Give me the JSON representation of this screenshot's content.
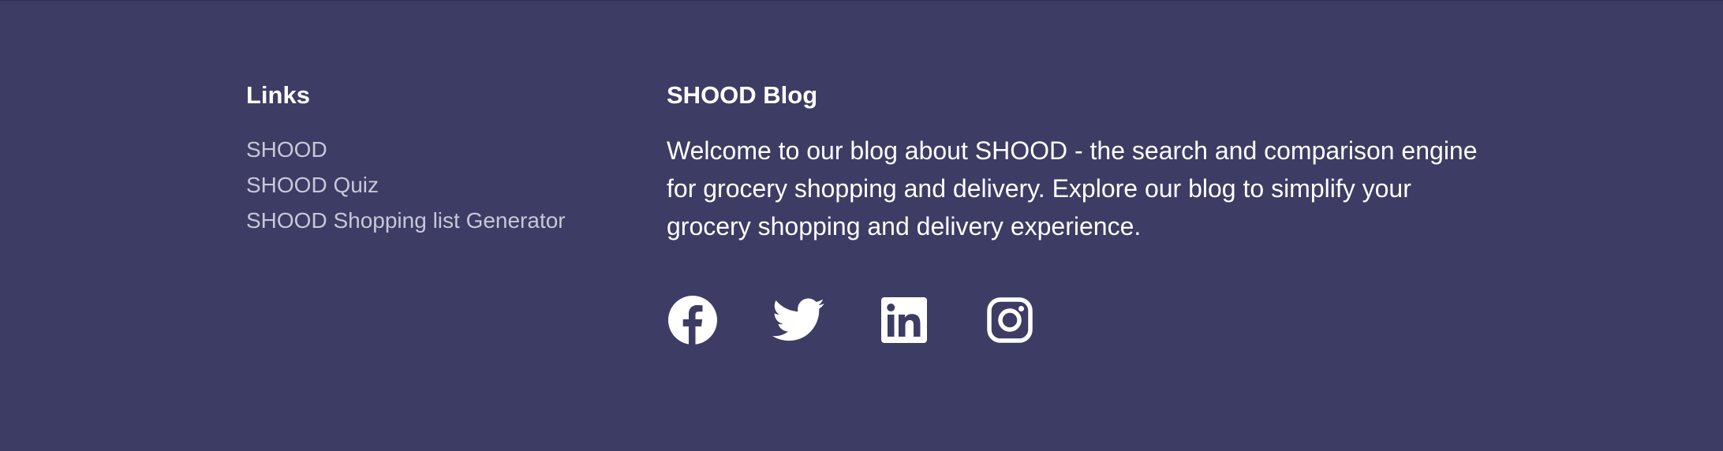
{
  "links": {
    "heading": "Links",
    "items": [
      {
        "label": "SHOOD"
      },
      {
        "label": "SHOOD Quiz"
      },
      {
        "label": "SHOOD Shopping list Generator"
      }
    ]
  },
  "blog": {
    "heading": "SHOOD Blog",
    "description": "Welcome to our blog about SHOOD - the search and comparison engine for grocery shopping and delivery. Explore our blog to simplify your grocery shopping and delivery experience."
  },
  "social": [
    {
      "icon": "facebook-icon"
    },
    {
      "icon": "twitter-icon"
    },
    {
      "icon": "linkedin-icon"
    },
    {
      "icon": "instagram-icon"
    }
  ],
  "colors": {
    "background": "#3c3c64",
    "heading": "#ffffff",
    "link": "#c7c7d9",
    "text": "#ffffff"
  }
}
